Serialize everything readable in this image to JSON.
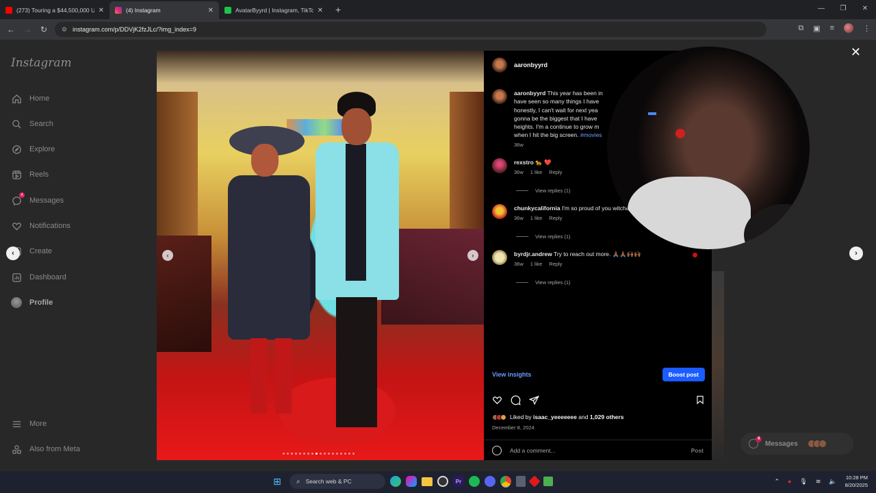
{
  "browser": {
    "tabs": [
      {
        "title": "(273) Touring a $44,500,000 Ul",
        "favicon_color": "#ff0000",
        "active": false
      },
      {
        "title": "(4) Instagram",
        "favicon_color": "#e1306c",
        "active": true
      },
      {
        "title": "AvatarByyrd | Instagram, TikTok",
        "favicon_color": "#1fc24a",
        "active": false
      }
    ],
    "new_tab": "+",
    "url": "instagram.com/p/DDVjK2fzJLc/?img_index=9"
  },
  "sidebar": {
    "logo": "Instagram",
    "items": [
      {
        "label": "Home",
        "icon": "home-icon"
      },
      {
        "label": "Search",
        "icon": "search-icon"
      },
      {
        "label": "Explore",
        "icon": "compass-icon"
      },
      {
        "label": "Reels",
        "icon": "reels-icon"
      },
      {
        "label": "Messages",
        "icon": "messenger-icon",
        "badge": "4"
      },
      {
        "label": "Notifications",
        "icon": "heart-icon"
      },
      {
        "label": "Create",
        "icon": "plus-square-icon"
      },
      {
        "label": "Dashboard",
        "icon": "dashboard-icon"
      },
      {
        "label": "Profile",
        "icon": "profile-avatar"
      }
    ],
    "more": "More",
    "also_from_meta": "Also from Meta"
  },
  "post": {
    "username": "aaronbyyrd",
    "caption_user": "aaronbyyrd",
    "caption_text": "This year has been in",
    "caption_lines": [
      "have seen so many things I have",
      "honestly, I can't wait for next yea",
      "gonna be the biggest that I have",
      "heights. I'm a continue to grow m",
      "when I hit the big screen."
    ],
    "caption_tag": "#movies",
    "caption_age": "36w",
    "comments": [
      {
        "user": "rexstro",
        "text": "🐆 ❤️",
        "age": "36w",
        "likes": "1 like",
        "reply": "Reply",
        "view_replies": "View replies (1)"
      },
      {
        "user": "chunkycalifornia",
        "text": "I'm so proud of you witcho stylish ass.",
        "age": "36w",
        "likes": "1 like",
        "reply": "Reply",
        "view_replies": "View replies (1)"
      },
      {
        "user": "byrdjr.andrew",
        "text": "Try to reach out more. 🙏🏾🙏🏾🙌🏾🙌🏾",
        "age": "36w",
        "likes": "1 like",
        "reply": "Reply",
        "view_replies": "View replies (1)"
      }
    ],
    "view_insights": "View insights",
    "boost_post": "Boost post",
    "liked_by_prefix": "Liked by",
    "liked_by_user": "isaac_yeeeeeee",
    "liked_by_and": "and",
    "liked_by_others": "1,029 others",
    "date": "December 8, 2024",
    "comment_placeholder": "Add a comment...",
    "post_button": "Post",
    "carousel_count": 18,
    "carousel_index": 9
  },
  "messages_pill": {
    "label": "Messages",
    "badge": "4"
  },
  "taskbar": {
    "search": "Search web & PC",
    "time": "10:28 PM",
    "date": "8/20/2025"
  }
}
